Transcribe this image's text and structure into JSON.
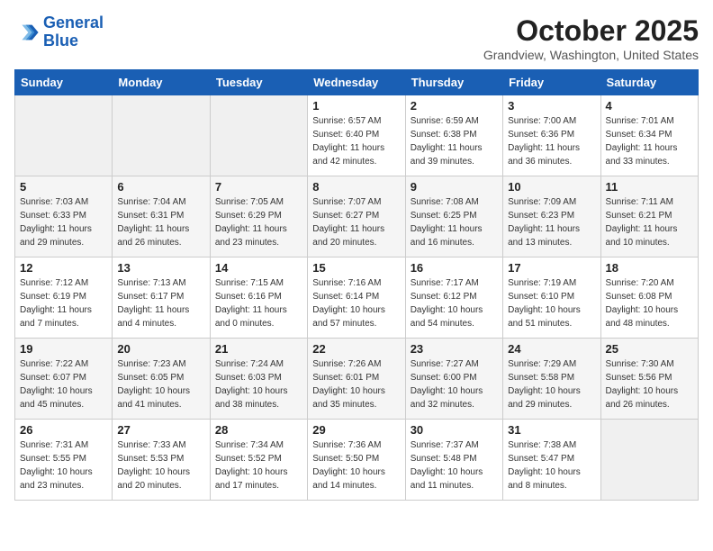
{
  "header": {
    "logo_line1": "General",
    "logo_line2": "Blue",
    "month": "October 2025",
    "location": "Grandview, Washington, United States"
  },
  "days_of_week": [
    "Sunday",
    "Monday",
    "Tuesday",
    "Wednesday",
    "Thursday",
    "Friday",
    "Saturday"
  ],
  "weeks": [
    [
      {
        "date": "",
        "info": ""
      },
      {
        "date": "",
        "info": ""
      },
      {
        "date": "",
        "info": ""
      },
      {
        "date": "1",
        "info": "Sunrise: 6:57 AM\nSunset: 6:40 PM\nDaylight: 11 hours\nand 42 minutes."
      },
      {
        "date": "2",
        "info": "Sunrise: 6:59 AM\nSunset: 6:38 PM\nDaylight: 11 hours\nand 39 minutes."
      },
      {
        "date": "3",
        "info": "Sunrise: 7:00 AM\nSunset: 6:36 PM\nDaylight: 11 hours\nand 36 minutes."
      },
      {
        "date": "4",
        "info": "Sunrise: 7:01 AM\nSunset: 6:34 PM\nDaylight: 11 hours\nand 33 minutes."
      }
    ],
    [
      {
        "date": "5",
        "info": "Sunrise: 7:03 AM\nSunset: 6:33 PM\nDaylight: 11 hours\nand 29 minutes."
      },
      {
        "date": "6",
        "info": "Sunrise: 7:04 AM\nSunset: 6:31 PM\nDaylight: 11 hours\nand 26 minutes."
      },
      {
        "date": "7",
        "info": "Sunrise: 7:05 AM\nSunset: 6:29 PM\nDaylight: 11 hours\nand 23 minutes."
      },
      {
        "date": "8",
        "info": "Sunrise: 7:07 AM\nSunset: 6:27 PM\nDaylight: 11 hours\nand 20 minutes."
      },
      {
        "date": "9",
        "info": "Sunrise: 7:08 AM\nSunset: 6:25 PM\nDaylight: 11 hours\nand 16 minutes."
      },
      {
        "date": "10",
        "info": "Sunrise: 7:09 AM\nSunset: 6:23 PM\nDaylight: 11 hours\nand 13 minutes."
      },
      {
        "date": "11",
        "info": "Sunrise: 7:11 AM\nSunset: 6:21 PM\nDaylight: 11 hours\nand 10 minutes."
      }
    ],
    [
      {
        "date": "12",
        "info": "Sunrise: 7:12 AM\nSunset: 6:19 PM\nDaylight: 11 hours\nand 7 minutes."
      },
      {
        "date": "13",
        "info": "Sunrise: 7:13 AM\nSunset: 6:17 PM\nDaylight: 11 hours\nand 4 minutes."
      },
      {
        "date": "14",
        "info": "Sunrise: 7:15 AM\nSunset: 6:16 PM\nDaylight: 11 hours\nand 0 minutes."
      },
      {
        "date": "15",
        "info": "Sunrise: 7:16 AM\nSunset: 6:14 PM\nDaylight: 10 hours\nand 57 minutes."
      },
      {
        "date": "16",
        "info": "Sunrise: 7:17 AM\nSunset: 6:12 PM\nDaylight: 10 hours\nand 54 minutes."
      },
      {
        "date": "17",
        "info": "Sunrise: 7:19 AM\nSunset: 6:10 PM\nDaylight: 10 hours\nand 51 minutes."
      },
      {
        "date": "18",
        "info": "Sunrise: 7:20 AM\nSunset: 6:08 PM\nDaylight: 10 hours\nand 48 minutes."
      }
    ],
    [
      {
        "date": "19",
        "info": "Sunrise: 7:22 AM\nSunset: 6:07 PM\nDaylight: 10 hours\nand 45 minutes."
      },
      {
        "date": "20",
        "info": "Sunrise: 7:23 AM\nSunset: 6:05 PM\nDaylight: 10 hours\nand 41 minutes."
      },
      {
        "date": "21",
        "info": "Sunrise: 7:24 AM\nSunset: 6:03 PM\nDaylight: 10 hours\nand 38 minutes."
      },
      {
        "date": "22",
        "info": "Sunrise: 7:26 AM\nSunset: 6:01 PM\nDaylight: 10 hours\nand 35 minutes."
      },
      {
        "date": "23",
        "info": "Sunrise: 7:27 AM\nSunset: 6:00 PM\nDaylight: 10 hours\nand 32 minutes."
      },
      {
        "date": "24",
        "info": "Sunrise: 7:29 AM\nSunset: 5:58 PM\nDaylight: 10 hours\nand 29 minutes."
      },
      {
        "date": "25",
        "info": "Sunrise: 7:30 AM\nSunset: 5:56 PM\nDaylight: 10 hours\nand 26 minutes."
      }
    ],
    [
      {
        "date": "26",
        "info": "Sunrise: 7:31 AM\nSunset: 5:55 PM\nDaylight: 10 hours\nand 23 minutes."
      },
      {
        "date": "27",
        "info": "Sunrise: 7:33 AM\nSunset: 5:53 PM\nDaylight: 10 hours\nand 20 minutes."
      },
      {
        "date": "28",
        "info": "Sunrise: 7:34 AM\nSunset: 5:52 PM\nDaylight: 10 hours\nand 17 minutes."
      },
      {
        "date": "29",
        "info": "Sunrise: 7:36 AM\nSunset: 5:50 PM\nDaylight: 10 hours\nand 14 minutes."
      },
      {
        "date": "30",
        "info": "Sunrise: 7:37 AM\nSunset: 5:48 PM\nDaylight: 10 hours\nand 11 minutes."
      },
      {
        "date": "31",
        "info": "Sunrise: 7:38 AM\nSunset: 5:47 PM\nDaylight: 10 hours\nand 8 minutes."
      },
      {
        "date": "",
        "info": ""
      }
    ]
  ]
}
